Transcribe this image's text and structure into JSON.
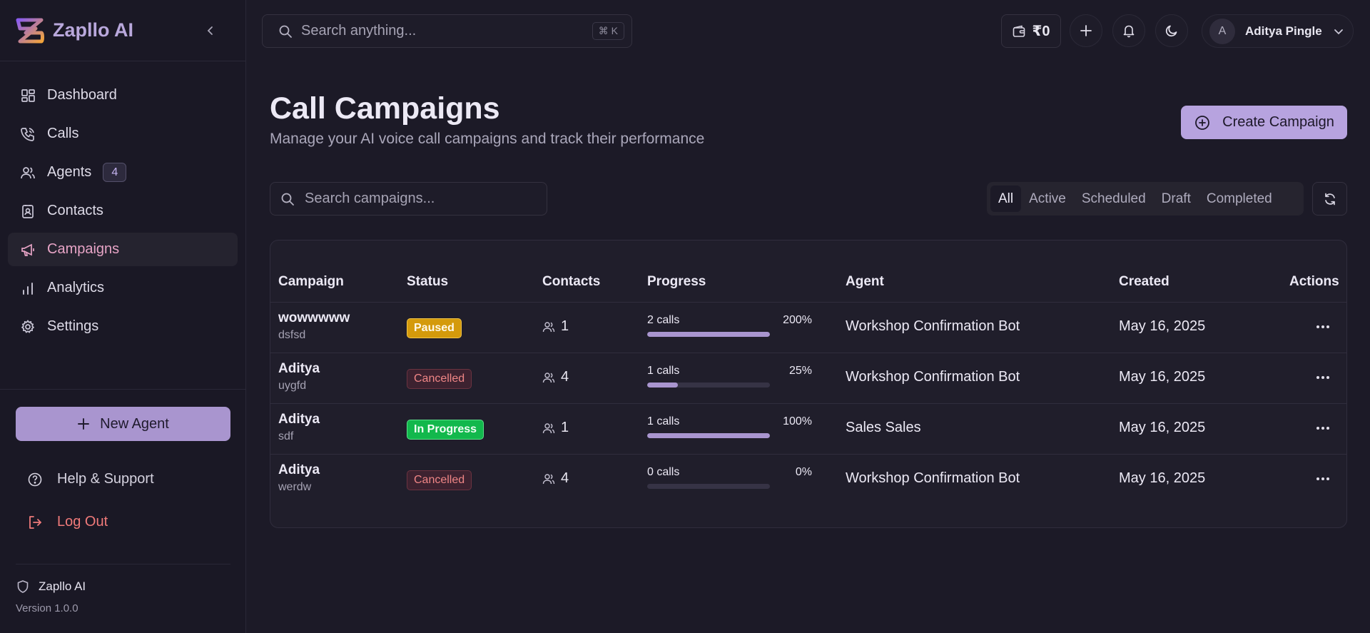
{
  "app": {
    "name": "Zapllo AI",
    "version": "Version 1.0.0"
  },
  "sidebar": {
    "items": [
      {
        "label": "Dashboard",
        "icon": "layout-grid-icon"
      },
      {
        "label": "Calls",
        "icon": "phone-icon"
      },
      {
        "label": "Agents",
        "icon": "users-icon",
        "badge": "4"
      },
      {
        "label": "Contacts",
        "icon": "contact-icon"
      },
      {
        "label": "Campaigns",
        "icon": "megaphone-icon",
        "active": true
      },
      {
        "label": "Analytics",
        "icon": "bar-chart-icon"
      },
      {
        "label": "Settings",
        "icon": "gear-icon"
      }
    ],
    "new_agent": "New Agent",
    "help": "Help & Support",
    "logout": "Log Out"
  },
  "topbar": {
    "search_placeholder": "Search anything...",
    "shortcut": "⌘ K",
    "wallet": "₹0",
    "user_initial": "A",
    "user_name": "Aditya Pingle"
  },
  "page": {
    "title": "Call Campaigns",
    "subtitle": "Manage your AI voice call campaigns and track their performance",
    "create_button": "Create Campaign",
    "search_placeholder": "Search campaigns...",
    "tabs": [
      "All",
      "Active",
      "Scheduled",
      "Draft",
      "Completed"
    ],
    "active_tab": "All"
  },
  "table": {
    "headers": [
      "Campaign",
      "Status",
      "Contacts",
      "Progress",
      "Agent",
      "Created",
      "Actions"
    ],
    "rows": [
      {
        "name": "wowwwww",
        "desc": "dsfsd",
        "status": "Paused",
        "status_kind": "paused",
        "contacts": "1",
        "calls": "2 calls",
        "percent": "200%",
        "fill": 1.0,
        "agent": "Workshop Confirmation Bot",
        "created": "May 16, 2025"
      },
      {
        "name": "Aditya",
        "desc": "uygfd",
        "status": "Cancelled",
        "status_kind": "cancelled",
        "contacts": "4",
        "calls": "1 calls",
        "percent": "25%",
        "fill": 0.25,
        "agent": "Workshop Confirmation Bot",
        "created": "May 16, 2025"
      },
      {
        "name": "Aditya",
        "desc": "sdf",
        "status": "In Progress",
        "status_kind": "progress",
        "contacts": "1",
        "calls": "1 calls",
        "percent": "100%",
        "fill": 1.0,
        "agent": "Sales Sales",
        "created": "May 16, 2025"
      },
      {
        "name": "Aditya",
        "desc": "werdw",
        "status": "Cancelled",
        "status_kind": "cancelled",
        "contacts": "4",
        "calls": "0 calls",
        "percent": "0%",
        "fill": 0.0,
        "agent": "Workshop Confirmation Bot",
        "created": "May 16, 2025"
      }
    ]
  },
  "colors": {
    "accent": "#a995cf",
    "active_nav": "#e7a4c6",
    "danger": "#f07a7a"
  }
}
